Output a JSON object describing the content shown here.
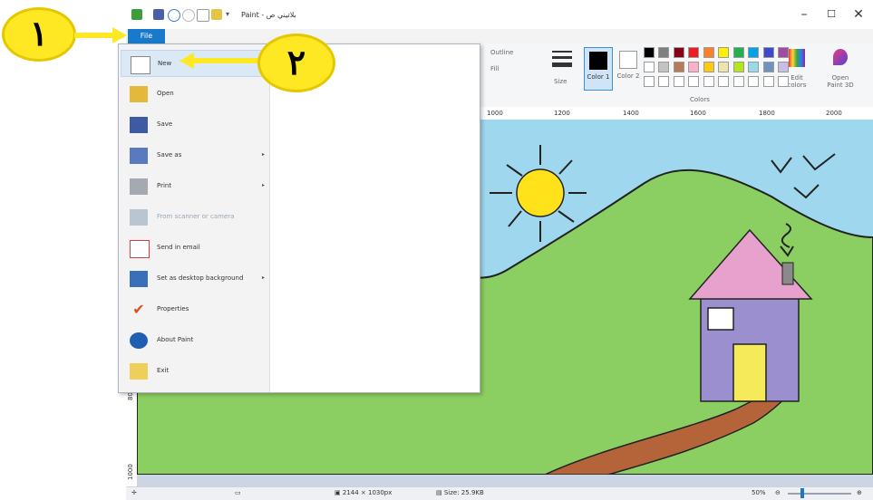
{
  "app": {
    "title": "Paint - بلاتيني ص"
  },
  "menu_bar": {
    "file_tab": "File"
  },
  "ribbon": {
    "outline_label": "Outline",
    "fill_label": "Fill",
    "size_label": "Size",
    "color1_label": "Color 1",
    "color2_label": "Color 2",
    "colors_group_label": "Colors",
    "edit_colors_label": "Edit colors",
    "open_paint3d_label": "Open Paint 3D",
    "palette_row1": [
      "#000000",
      "#7f7f7f",
      "#880015",
      "#ed1c24",
      "#ff7f27",
      "#fff200",
      "#22b14c",
      "#00a2e8",
      "#3f48cc",
      "#a349a4"
    ],
    "palette_row2": [
      "#ffffff",
      "#c3c3c3",
      "#b97a57",
      "#ffaec9",
      "#ffc90e",
      "#efe4b0",
      "#b5e61d",
      "#99d9ea",
      "#7092be",
      "#c8bfe7"
    ],
    "palette_row3": [
      "#ffffff",
      "#ffffff",
      "#ffffff",
      "#ffffff",
      "#ffffff",
      "#ffffff",
      "#ffffff",
      "#ffffff",
      "#ffffff",
      "#ffffff"
    ]
  },
  "ruler": {
    "ticks": [
      "1000",
      "1200",
      "1400",
      "1600",
      "1800",
      "2000"
    ]
  },
  "left_ruler": {
    "ticks": [
      "800",
      "1000"
    ]
  },
  "file_menu": {
    "items": [
      {
        "label": "New",
        "enabled": true,
        "arrow": false
      },
      {
        "label": "Open",
        "enabled": true,
        "arrow": false
      },
      {
        "label": "Save",
        "enabled": true,
        "arrow": false
      },
      {
        "label": "Save as",
        "enabled": true,
        "arrow": true
      },
      {
        "label": "Print",
        "enabled": true,
        "arrow": true
      },
      {
        "label": "From scanner or camera",
        "enabled": false,
        "arrow": false
      },
      {
        "label": "Send in email",
        "enabled": true,
        "arrow": false
      },
      {
        "label": "Set as desktop background",
        "enabled": true,
        "arrow": true
      },
      {
        "label": "Properties",
        "enabled": true,
        "arrow": false
      },
      {
        "label": "About Paint",
        "enabled": true,
        "arrow": false
      },
      {
        "label": "Exit",
        "enabled": true,
        "arrow": false
      }
    ]
  },
  "status_bar": {
    "dimensions": "2144 × 1030px",
    "size": "Size: 25.9KB",
    "zoom": "50%"
  },
  "callouts": {
    "one": "١",
    "two": "٢"
  },
  "colors": {
    "accent": "#1979ca",
    "sky": "#9fd8ee",
    "grass": "#8bcf62",
    "house_roof": "#e6a1cc",
    "house_wall": "#9b8fd0",
    "door": "#f5ea5a",
    "sun": "#ffe21a",
    "path": "#b5643a",
    "callout": "#fde823"
  }
}
